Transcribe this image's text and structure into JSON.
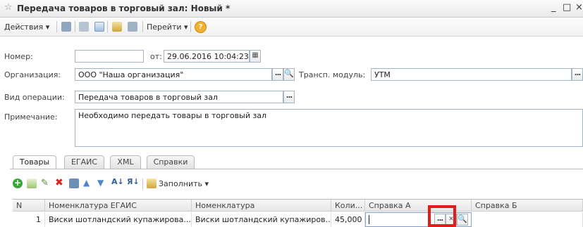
{
  "window": {
    "title": "Передача товаров в торговый зал: Новый *",
    "controls": {
      "minimize": "_",
      "maximize": "□",
      "close": "×"
    }
  },
  "toolbar": {
    "actions_label": "Действия",
    "goto_label": "Перейти",
    "help_label": "?"
  },
  "form": {
    "number_label": "Номер:",
    "number_value": "",
    "date_label": "от:",
    "date_value": "29.06.2016 10:04:23",
    "org_label": "Организация:",
    "org_value": "ООО \"Наша организация\"",
    "transport_label": "Трансп. модуль:",
    "transport_value": "УТМ",
    "operation_label": "Вид операции:",
    "operation_value": "Передача товаров в торговый зал",
    "note_label": "Примечание:",
    "note_value": "Необходимо передать товары в торговый зал",
    "select_glyph": "...",
    "search_glyph": "🔍"
  },
  "tabs": [
    {
      "label": "Товары",
      "active": true
    },
    {
      "label": "ЕГАИС",
      "active": false
    },
    {
      "label": "XML",
      "active": false
    },
    {
      "label": "Справки",
      "active": false
    }
  ],
  "grid_toolbar": {
    "fill_label": "Заполнить"
  },
  "table": {
    "columns": [
      "N",
      "Номенклатура ЕГАИС",
      "Номенклатура",
      "Коли...",
      "Справка А",
      "Справка Б"
    ],
    "rows": [
      [
        "1",
        "Виски шотландский купажирова...",
        "Виски шотландский купажиров...",
        "45,000",
        "",
        ""
      ]
    ]
  },
  "colors": {
    "highlight": "#e31b1b",
    "field_border": "#a7b4c1"
  }
}
